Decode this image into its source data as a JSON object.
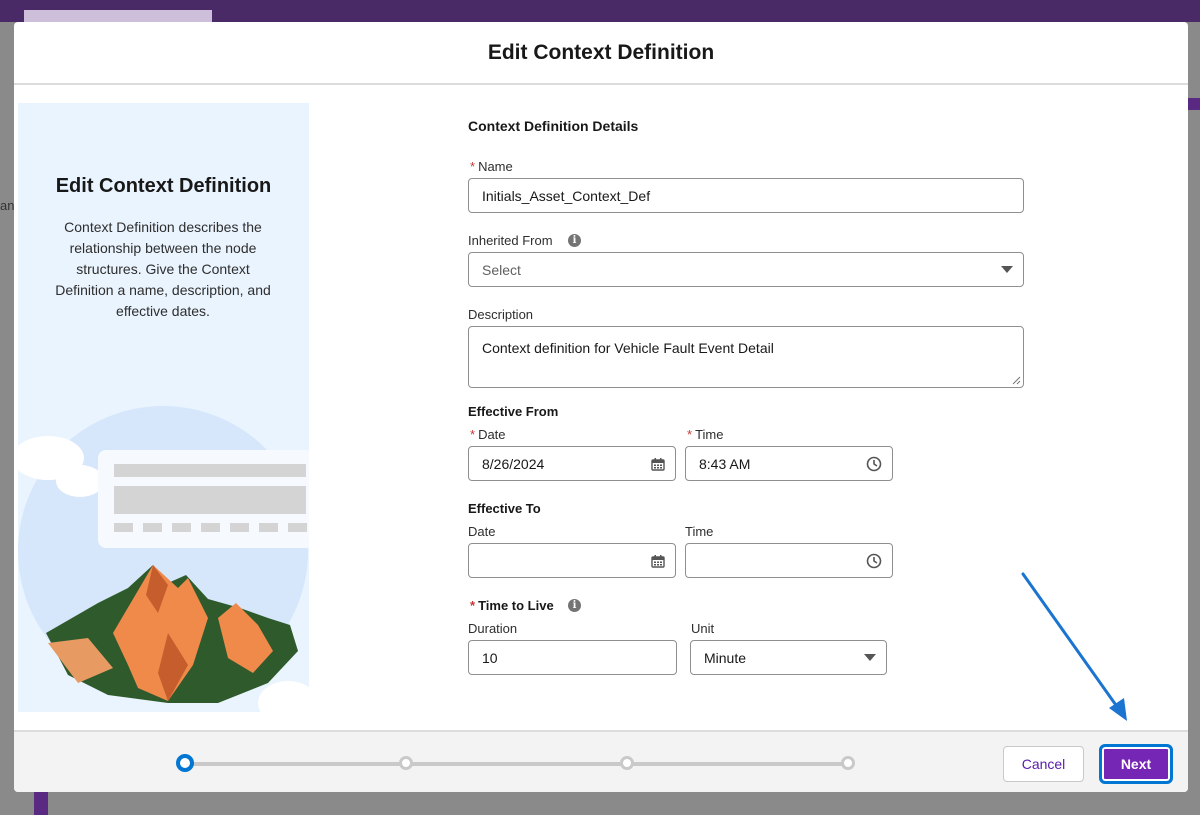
{
  "modal": {
    "title": "Edit Context Definition"
  },
  "side_panel": {
    "title": "Edit Context Definition",
    "description": "Context Definition describes the relationship between the node structures. Give the Context Definition a name, description, and effective dates."
  },
  "form": {
    "section_title": "Context Definition Details",
    "name": {
      "label": "Name",
      "required_mark": "*",
      "value": "Initials_Asset_Context_Def"
    },
    "inherited_from": {
      "label": "Inherited From",
      "placeholder": "Select",
      "icon": "info-icon"
    },
    "description": {
      "label": "Description",
      "value": "Context definition for Vehicle Fault Event Detail"
    },
    "effective_from": {
      "title": "Effective From",
      "date_label": "Date",
      "date_value": "8/26/2024",
      "time_label": "Time",
      "time_value": "8:43 AM",
      "required_mark": "*"
    },
    "effective_to": {
      "title": "Effective To",
      "date_label": "Date",
      "date_value": "",
      "time_label": "Time",
      "time_value": ""
    },
    "time_to_live": {
      "title": "Time to Live",
      "required_mark": "*",
      "duration_label": "Duration",
      "duration_value": "10",
      "unit_label": "Unit",
      "unit_value": "Minute"
    }
  },
  "footer": {
    "cancel_label": "Cancel",
    "next_label": "Next",
    "current_step": 1,
    "total_steps": 4
  },
  "background": {
    "edge_text": "an"
  },
  "colors": {
    "brand_purple": "#7526b5",
    "focus_blue": "#0176d3",
    "required_red": "#c23934",
    "panel_bg": "#eaf4fe"
  }
}
